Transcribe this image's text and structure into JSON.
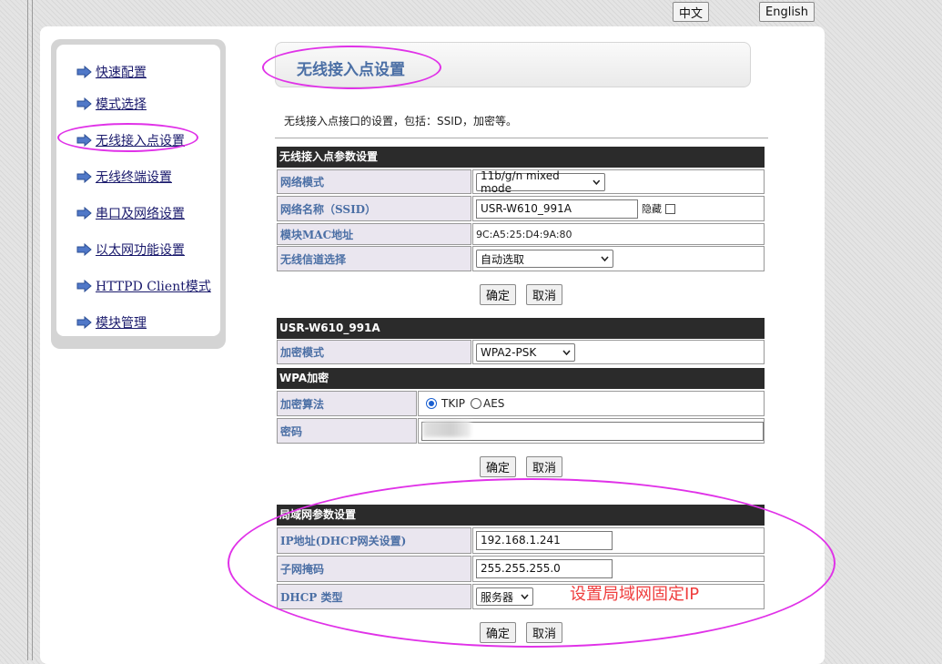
{
  "lang": {
    "zh": "中文",
    "en": "English"
  },
  "sidebar": {
    "items": [
      {
        "label": "快速配置"
      },
      {
        "label": "模式选择"
      },
      {
        "label": "无线接入点设置"
      },
      {
        "label": "无线终端设置"
      },
      {
        "label": "串口及网络设置"
      },
      {
        "label": "以太网功能设置"
      },
      {
        "label": "HTTPD Client模式"
      },
      {
        "label": "模块管理"
      }
    ]
  },
  "page": {
    "title": "无线接入点设置",
    "description": "无线接入点接口的设置，包括：SSID，加密等。"
  },
  "ap_section": {
    "header": "无线接入点参数设置",
    "network_mode_label": "网络模式",
    "network_mode_value": "11b/g/n mixed mode",
    "ssid_label": "网络名称（SSID）",
    "ssid_value": "USR-W610_991A",
    "hide_label": "隐藏",
    "mac_label": "模块MAC地址",
    "mac_value": "9C:A5:25:D4:9A:80",
    "channel_label": "无线信道选择",
    "channel_value": "自动选取",
    "ok": "确定",
    "cancel": "取消"
  },
  "security_section": {
    "header": "USR-W610_991A",
    "enc_mode_label": "加密模式",
    "enc_mode_value": "WPA2-PSK",
    "wpa_header": "WPA加密",
    "algo_label": "加密算法",
    "algo_tkip": "TKIP",
    "algo_aes": "AES",
    "password_label": "密码",
    "ok": "确定",
    "cancel": "取消"
  },
  "lan_section": {
    "header": "局域网参数设置",
    "ip_label": "IP地址(DHCP网关设置)",
    "ip_value": "192.168.1.241",
    "mask_label": "子网掩码",
    "mask_value": "255.255.255.0",
    "dhcp_label": "DHCP 类型",
    "dhcp_value": "服务器",
    "ok": "确定",
    "cancel": "取消"
  },
  "annotation": {
    "text": "设置局域网固定IP",
    "color": "#ef3d3d"
  },
  "colors": {
    "accent": "#4b6fa5",
    "highlight": "#e032e8",
    "header_bg": "#2b2b2b",
    "label_bg": "#eae6ef"
  },
  "icons": {
    "nav": "arrow-right-icon"
  }
}
